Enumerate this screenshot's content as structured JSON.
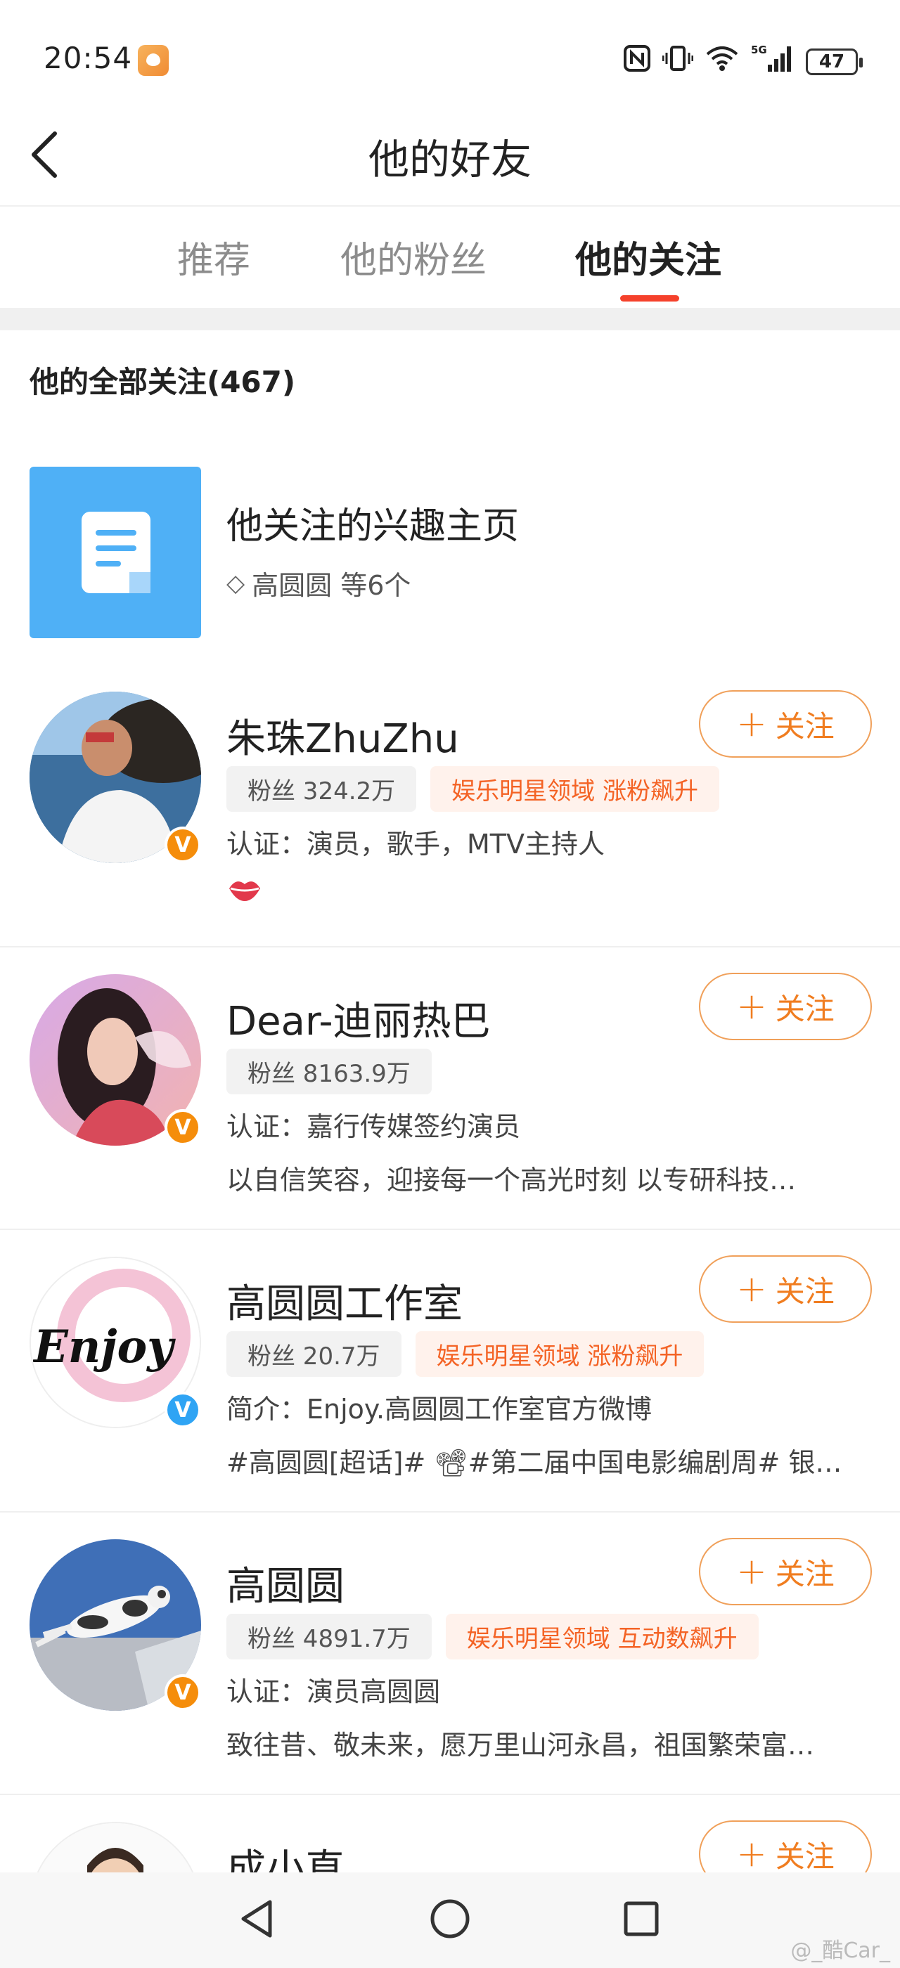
{
  "status_bar": {
    "time": "20:54",
    "network": "5G",
    "battery": "47",
    "icons": [
      "nfc-icon",
      "vibrate-icon",
      "wifi-icon",
      "signal-icon",
      "battery-icon"
    ]
  },
  "header": {
    "title": "他的好友"
  },
  "tabs": [
    {
      "label": "推荐",
      "active": false
    },
    {
      "label": "他的粉丝",
      "active": false
    },
    {
      "label": "他的关注",
      "active": true
    }
  ],
  "section": {
    "title": "他的全部关注(467)"
  },
  "interest": {
    "name": "他关注的兴趣主页",
    "sub": "高圆圆 等6个"
  },
  "follow_label": "关注",
  "users": [
    {
      "name": "朱珠ZhuZhu",
      "fans": "粉丝 324.2万",
      "hot": "娱乐明星领域 涨粉飙升",
      "desc": "认证：演员，歌手，MTV主持人",
      "desc2": "",
      "badge": "V",
      "badge_color": "#f58d0b"
    },
    {
      "name": "Dear-迪丽热巴",
      "fans": "粉丝 8163.9万",
      "hot": "",
      "desc": "认证：嘉行传媒签约演员",
      "desc2": "以自信笑容，迎接每一个高光时刻 以专研科技…",
      "badge": "V",
      "badge_color": "#f58d0b"
    },
    {
      "name": "高圆圆工作室",
      "fans": "粉丝 20.7万",
      "hot": "娱乐明星领域 涨粉飙升",
      "desc": "简介：Enjoy.高圆圆工作室官方微博",
      "desc2": "#高圆圆[超话]# 📽#第二届中国电影编剧周# 银…",
      "avatar_text": "Enjoy",
      "badge": "V",
      "badge_color": "#2fa4f4"
    },
    {
      "name": "高圆圆",
      "fans": "粉丝 4891.7万",
      "hot": "娱乐明星领域 互动数飙升",
      "desc": "认证：演员高圆圆",
      "desc2": "致往昔、敬未来，愿万里山河永昌，祖国繁荣富…",
      "badge": "V",
      "badge_color": "#f58d0b"
    },
    {
      "name": "成小直",
      "fans": "",
      "hot": "",
      "desc": "",
      "desc2": ""
    }
  ],
  "watermark": "@_酷Car_",
  "colors": {
    "accent": "#f5412b",
    "follow": "#f07d20",
    "hot_text": "#f46325",
    "interest_bg": "#4fb0f6"
  }
}
